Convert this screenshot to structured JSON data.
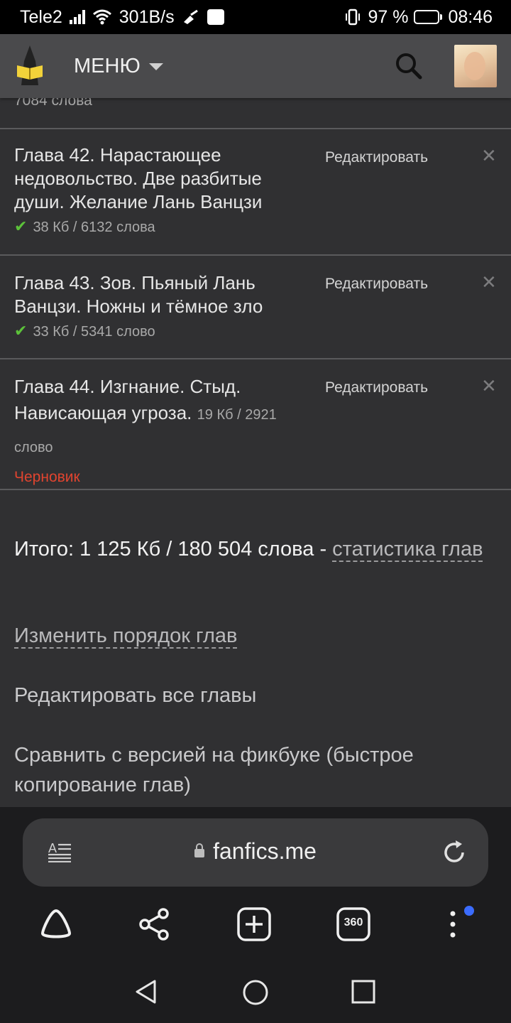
{
  "status_bar": {
    "carrier": "Tele2",
    "speed": "301B/s",
    "battery": "97 %",
    "battery_level": 0.97,
    "time": "08:46"
  },
  "header": {
    "menu_label": "МЕНЮ",
    "icons": [
      "logo-icon",
      "chevron-down-icon",
      "search-icon",
      "avatar"
    ]
  },
  "content": {
    "prev_chapter_words": "7084 слова",
    "chapters": [
      {
        "title": "Глава 42. Нарастающее недовольство. Две разбитые души. Желание Лань Ванцзи",
        "meta": "38 Кб / 6132 слова",
        "checked": true,
        "edit_label": "Редактировать",
        "delete_icon": "close-icon"
      },
      {
        "title": "Глава 43. Зов. Пьяный Лань Ванцзи. Ножны и тёмное зло",
        "meta": "33 Кб / 5341 слово",
        "checked": true,
        "edit_label": "Редактировать",
        "delete_icon": "close-icon"
      },
      {
        "title": "Глава 44. Изгнание. Стыд. Нависающая угроза.",
        "meta": "19 Кб / 2921 слово",
        "checked": false,
        "status": "Черновик",
        "edit_label": "Редактировать",
        "delete_icon": "close-icon"
      }
    ],
    "total_prefix": "Итого: 1 125 Кб / 180 504 слова - ",
    "total_link": "статистика глав",
    "actions": {
      "reorder": "Изменить порядок глав",
      "edit_all": "Редактировать все главы",
      "compare": "Сравнить с версией на фикбуке (быстрое копирование глав)"
    }
  },
  "browser": {
    "url": "fanfics.me",
    "tabs_count": "360",
    "icons": [
      "reader-mode-icon",
      "lock-icon",
      "reload-icon",
      "home-icon",
      "share-icon",
      "new-tab-icon",
      "tabs-icon",
      "more-icon"
    ]
  },
  "colors": {
    "content_bg": "#303032",
    "header_bg": "#4a4a4c",
    "draft": "#e0442f",
    "check": "#5cc23a",
    "notification_dot": "#3b6cff"
  }
}
